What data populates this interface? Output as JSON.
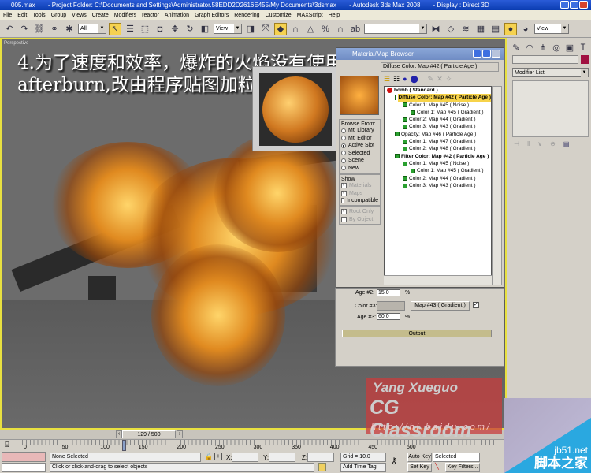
{
  "titlebar": {
    "file": "005.max",
    "project": "- Project Folder: C:\\Documents and Settings\\Administrator.58EDD2D2616E455\\My Documents\\3dsmax",
    "app": "- Autodesk 3ds Max 2008",
    "display": "- Display : Direct 3D"
  },
  "menu": [
    "File",
    "Edit",
    "Tools",
    "Group",
    "Views",
    "Create",
    "Modifiers",
    "reactor",
    "Animation",
    "Graph Editors",
    "Rendering",
    "Customize",
    "MAXScript",
    "Help"
  ],
  "toolbar": {
    "selection_filter": "All",
    "ref_coord": "View",
    "named_sel": "",
    "view_dd": "View"
  },
  "viewport": {
    "label": "Perspective",
    "overlay_line1": "4.为了速度和效率，爆炸的火焰没有使用",
    "overlay_line2": "afterburn,改由程序贴图加粒子面片实现。"
  },
  "browser": {
    "title": "Material/Map Browser",
    "path": "Diffuse Color: Map #42  ( Particle Age )",
    "browse_from_label": "Browse From:",
    "browse_from": [
      {
        "label": "Mtl Library",
        "selected": false
      },
      {
        "label": "Mtl Editor",
        "selected": false
      },
      {
        "label": "Active Slot",
        "selected": true
      },
      {
        "label": "Selected",
        "selected": false
      },
      {
        "label": "Scene",
        "selected": false
      },
      {
        "label": "New",
        "selected": false
      }
    ],
    "show_label": "Show",
    "show": [
      {
        "label": "Materials",
        "checked": true,
        "enabled": false
      },
      {
        "label": "Maps",
        "checked": true,
        "enabled": false
      },
      {
        "label": "Incompatible",
        "checked": false,
        "enabled": true
      }
    ],
    "extra": [
      {
        "label": "Root Only",
        "checked": true
      },
      {
        "label": "By Object",
        "checked": false
      }
    ],
    "tree": [
      {
        "text": "bomb  ( Standard )",
        "level": 0,
        "icon": "red",
        "bold": true
      },
      {
        "text": "Diffuse Color: Map #42  ( Particle Age )",
        "level": 1,
        "bold": true,
        "highlight": true
      },
      {
        "text": "Color 1: Map #45  ( Noise )",
        "level": 2
      },
      {
        "text": "Color 1: Map #45  ( Gradient )",
        "level": 3
      },
      {
        "text": "Color 2: Map #44  ( Gradient )",
        "level": 2
      },
      {
        "text": "Color 3: Map #43  ( Gradient )",
        "level": 2
      },
      {
        "text": "Opacity: Map #46  ( Particle Age )",
        "level": 1
      },
      {
        "text": "Color 1: Map #47  ( Gradient )",
        "level": 2
      },
      {
        "text": "Color 2: Map #48  ( Gradient )",
        "level": 2
      },
      {
        "text": "Filter Color: Map #42  ( Particle Age )",
        "level": 1,
        "bold": true
      },
      {
        "text": "Color 1: Map #45  ( Noise )",
        "level": 2
      },
      {
        "text": "Color 1: Map #45  ( Gradient )",
        "level": 3
      },
      {
        "text": "Color 2: Map #44  ( Gradient )",
        "level": 2
      },
      {
        "text": "Color 3: Map #43  ( Gradient )",
        "level": 2
      }
    ]
  },
  "params": {
    "age2_label": "Age #2:",
    "age2": "15.0",
    "color3_label": "Color #3:",
    "map3": "Map #43  ( Gradient )",
    "age3_label": "Age #3:",
    "age3": "60.0",
    "pct": "%",
    "output": "Output"
  },
  "cmd": {
    "modifier_list": "Modifier List",
    "accent": "#a01040"
  },
  "timeline": {
    "frame": "129 / 500",
    "ticks": [
      "0",
      "50",
      "100",
      "150",
      "200",
      "250",
      "300",
      "350",
      "400",
      "450",
      "500"
    ],
    "progress": 0.258
  },
  "status": {
    "selection": "None Selected",
    "prompt": "Click or click-and-drag to select objects",
    "x_label": "X:",
    "y_label": "Y:",
    "z_label": "Z:",
    "grid": "Grid = 10.0",
    "add_time_tag": "Add Time Tag",
    "auto_key": "Auto Key",
    "set_key": "Set Key",
    "selected_dd": "Selected",
    "key_filters": "Key Filters..."
  },
  "watermark": {
    "line1": "Yang Xueguo",
    "line2": "CG Classroom",
    "url": "http://hi.baidu.com/",
    "site": "jb51.net",
    "site_cn": "脚本之家"
  }
}
